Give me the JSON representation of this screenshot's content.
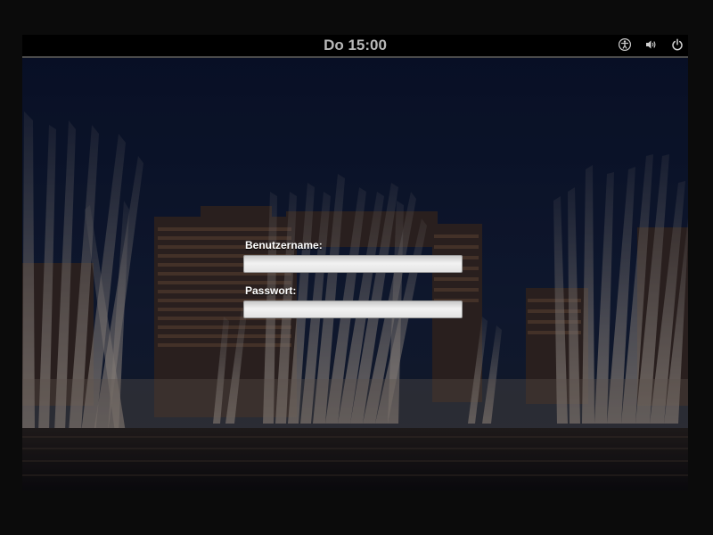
{
  "topbar": {
    "clock": "Do 15:00",
    "icons": [
      "accessibility-icon",
      "volume-icon",
      "power-icon"
    ]
  },
  "login": {
    "username_label": "Benutzername:",
    "username_value": "",
    "password_label": "Passwort:",
    "password_value": ""
  },
  "colors": {
    "topbar_bg": "#000000",
    "clock_text": "#b8b8b8",
    "label_text": "#ffffff"
  }
}
